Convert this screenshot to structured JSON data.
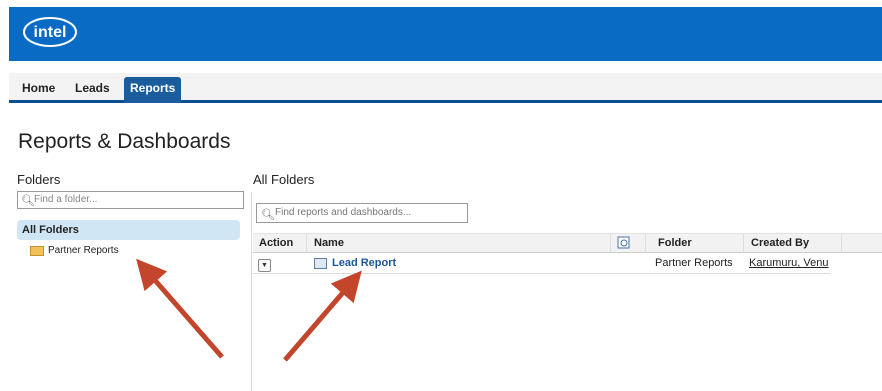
{
  "brand": {
    "logo_text": "intel",
    "header_color": "#0a6bc4"
  },
  "nav": {
    "tabs": [
      {
        "label": "Home"
      },
      {
        "label": "Leads"
      },
      {
        "label": "Reports",
        "active": true
      }
    ]
  },
  "page": {
    "title": "Reports & Dashboards"
  },
  "folders": {
    "label": "Folders",
    "search_placeholder": "Find a folder...",
    "all_folders": "All Folders",
    "items": [
      {
        "label": "Partner Reports"
      }
    ]
  },
  "reports": {
    "label": "All Folders",
    "search_placeholder": "Find reports and dashboards...",
    "columns": {
      "action": "Action",
      "name": "Name",
      "folder": "Folder",
      "created_by": "Created By"
    },
    "rows": [
      {
        "name": "Lead Report",
        "folder": "Partner Reports",
        "created_by": "Karumuru, Venu"
      }
    ]
  },
  "annotations": {
    "arrow_color": "#c2452c"
  }
}
